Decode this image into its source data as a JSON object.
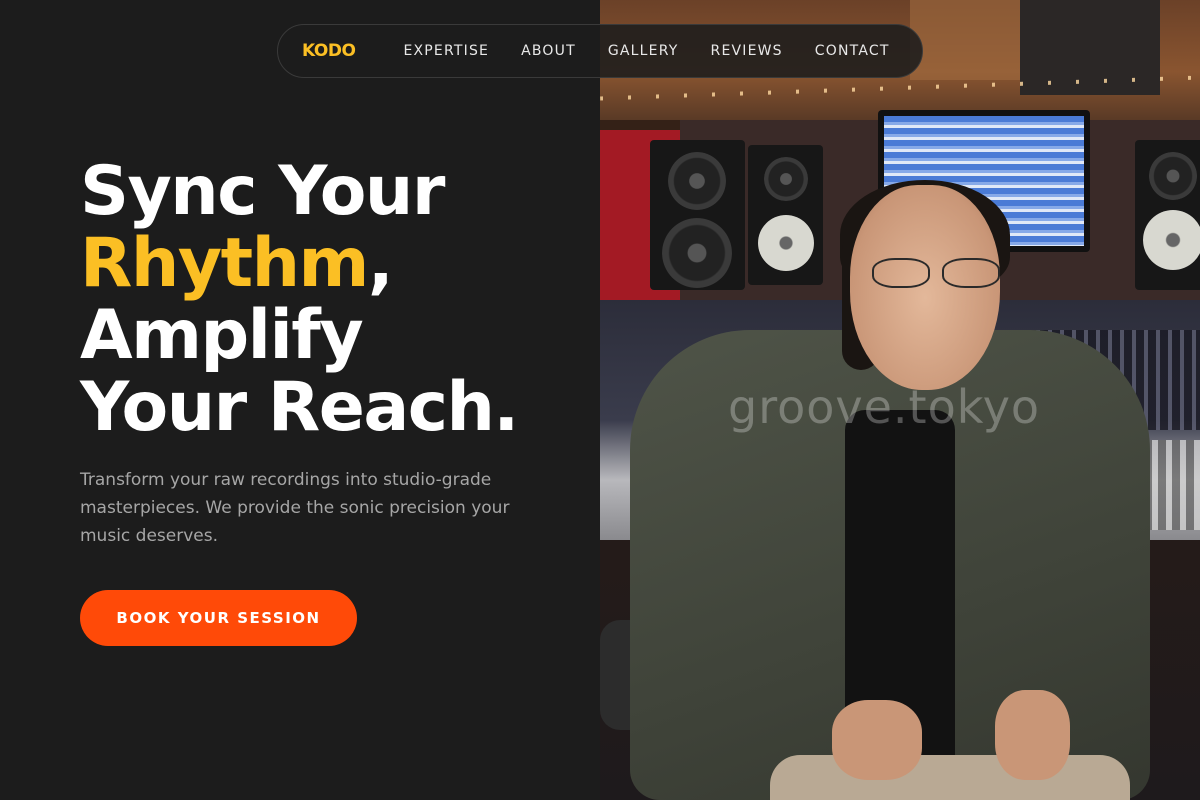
{
  "nav": {
    "logo": "KODO",
    "links": [
      "EXPERTISE",
      "ABOUT",
      "GALLERY",
      "REVIEWS",
      "CONTACT"
    ]
  },
  "hero": {
    "headline_line1": "Sync Your",
    "headline_accent": "Rhythm",
    "headline_comma": ",",
    "headline_line3": "Amplify",
    "headline_line4": "Your Reach.",
    "subtitle": "Transform your raw recordings into studio-grade masterpieces. We provide the sonic precision your music deserves.",
    "cta_label": "BOOK YOUR SESSION"
  },
  "photo": {
    "watermark": "groove.tokyo"
  },
  "colors": {
    "background": "#1c1c1c",
    "accent_yellow": "#fbbf24",
    "cta_orange": "#ff4a08",
    "text_white": "#ffffff",
    "text_muted": "#a6a6a6"
  }
}
